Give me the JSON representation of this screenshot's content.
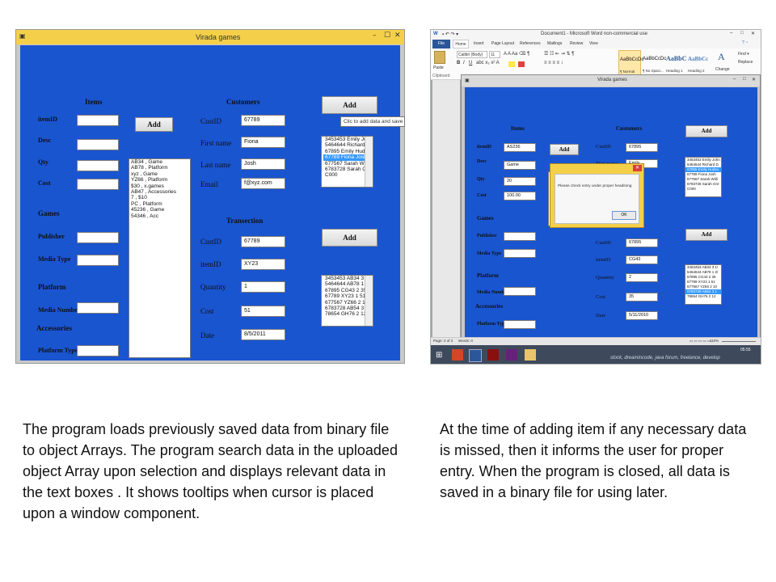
{
  "left_window": {
    "title": "Virada games",
    "controls": {
      "minimize": "–",
      "maximize": "☐",
      "close": "✕"
    },
    "sections": {
      "items": "Items",
      "customers": "Customers",
      "transaction": "Transection",
      "games": "Games",
      "platform": "Platform",
      "accessories": "Accessories"
    },
    "labels": {
      "itemid": "itemID",
      "desc": "Desc",
      "qty": "Qty",
      "cost": "Cost",
      "publisher": "Publisher",
      "media_type": "Media Type",
      "media_number": "Media Number",
      "platform_type": "Platform Type"
    },
    "customer_labels": {
      "custid": "CustID",
      "first_name": "First name",
      "last_name": "Last name",
      "email": "Email"
    },
    "customer_values": {
      "custid": "67789",
      "first_name": "Fiona",
      "last_name": "Josh",
      "email": "f@xyz.com"
    },
    "transaction_labels": {
      "custid": "CustID",
      "itemid": "itemID",
      "quantity": "Quantity",
      "cost": "Cost",
      "date": "Date"
    },
    "transaction_values": {
      "custid": "67789",
      "itemid": "XY23",
      "quantity": "1",
      "cost": "51",
      "date": "8/5/2011"
    },
    "add_item_label": "Add",
    "add_customer_label": "Add",
    "add_transaction_label": "Add",
    "tooltip": "Clic to add data and save",
    "items_list": [
      "AB34 , Game",
      "AB78 , Platform",
      "xyz , Game",
      "YZ66 , Platform",
      "$30 , x.games",
      "AB47 , Accessories",
      "7 , $10",
      "PC , Platform",
      "45236 , Game",
      "54346 , Acc"
    ],
    "customers_list": [
      "3453453  Emily Johr",
      "5464644  Richard D.",
      "67895  Emily Hudson",
      "67789  Fiona Josh",
      "677567  Sarah Willia",
      "6783728  Sarah Gre",
      "C000"
    ],
    "customers_selected_index": 3,
    "transactions_list": [
      "3453453  AB34  3 1!",
      "5464644  AB78  1 2/",
      "67895  CG43  2 35",
      "67789  XY23  1 51",
      "677567  YZ66  2 10",
      "6783728  AB54  3 1",
      "78654  GH76  2 12"
    ]
  },
  "word_window": {
    "title": "Document1 - Microsoft Word non-commercial use",
    "tabs": [
      "File",
      "Home",
      "Insert",
      "Page Layout",
      "References",
      "Mailings",
      "Review",
      "View"
    ],
    "font_name": "Calibri (Body)",
    "font_size": "11",
    "paste_label": "Paste",
    "clipboard_label": "Clipboard",
    "styles": [
      {
        "preview": "AaBbCcDc",
        "name": "¶ Normal"
      },
      {
        "preview": "AaBbCcDc",
        "name": "¶ No Spaci..."
      },
      {
        "preview": "AaBbC",
        "name": "Heading 1"
      },
      {
        "preview": "AaBbCc",
        "name": "Heading 2"
      }
    ],
    "change_styles": "Change",
    "find_label": "Find ▾",
    "replace_label": "Replace",
    "status_page": "Page: 2 of 2",
    "status_words": "Words: 0",
    "zoom": "110%",
    "taskbar_text": "stock, dreamincode, java forum, freelance, develop",
    "clock": "05:55",
    "inner": {
      "title": "Virada games",
      "sections": {
        "items": "Items",
        "customers": "Customers",
        "games": "Games",
        "platform": "Platform",
        "accessories": "Accessories"
      },
      "labels": {
        "itemid": "itemID",
        "desc": "Desc",
        "qty": "Qty",
        "cost": "Cost",
        "publisher": "Publisher",
        "media_type": "Media Type",
        "media_number": "Media Number",
        "platform_type": "Platform Type"
      },
      "item_values": {
        "itemid": "AS236",
        "desc": "Game",
        "qty": "20",
        "cost": "100.00"
      },
      "customer_labels": {
        "custid": "CustID",
        "first_name": "First name"
      },
      "customer_values": {
        "custid": "67895",
        "first_name": "Emily"
      },
      "transaction_labels": {
        "custid": "CustID",
        "itemid": "itemID",
        "quantity": "Quantity",
        "cost": "Cost",
        "date": "Date"
      },
      "transaction_values": {
        "custid": "67895",
        "itemid": "CG43",
        "quantity": "2",
        "cost": "35",
        "date": "5/11/2010"
      },
      "add_label": "Add",
      "customers_list": [
        "3453453  Emily John",
        "5464644  Richard D.",
        "67895  Emily Hudso",
        "67789  Fiona Josh",
        "677567  Sarah Willi",
        "6783728  Sarah Gre",
        "C000"
      ],
      "customers_selected_index": 2,
      "transactions_list": [
        "3453453  AB34  3 1!",
        "5464644  AB78  1 2/",
        "67895  CG43  2 35",
        "67789  XY23  1 51",
        "677567  YZ66  2 10",
        "6783728  AB54  3 1",
        "78654  GH76  2 12"
      ],
      "transactions_selected_index": 5,
      "dialog": {
        "message": "Please check entry under proper headining",
        "ok": "OK",
        "close": "✕"
      }
    }
  },
  "captions": {
    "left": "The program loads previously saved data from binary file to  object Arrays. The program search data in the uploaded object Array upon selection and displays  relevant data in the text boxes . It shows tooltips when cursor is placed upon a window component.",
    "right": "At the time of adding item if any necessary data is missed, then it informs the user for proper entry. When the program is closed, all data is saved in a binary file for using later."
  }
}
